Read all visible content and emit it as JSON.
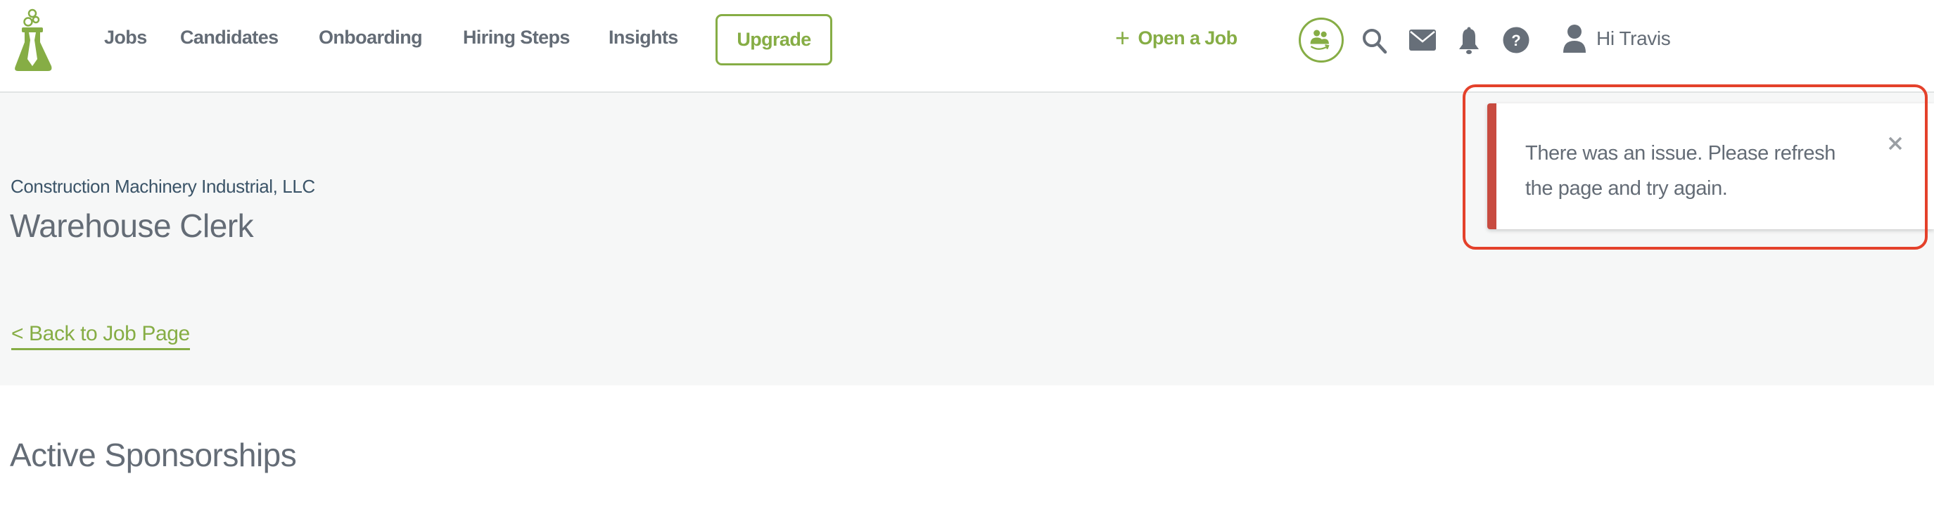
{
  "header": {
    "logo": "flask-tie-logo",
    "nav": [
      {
        "label": "Jobs"
      },
      {
        "label": "Candidates"
      },
      {
        "label": "Onboarding"
      },
      {
        "label": "Hiring Steps"
      },
      {
        "label": "Insights"
      }
    ],
    "upgrade_label": "Upgrade",
    "open_job": {
      "icon": "plus-icon",
      "label": "Open a Job"
    },
    "icons": [
      "talent-pool-icon",
      "search-icon",
      "mail-icon",
      "bell-icon",
      "help-icon"
    ],
    "user": {
      "icon": "user-icon",
      "greeting": "Hi Travis"
    }
  },
  "job": {
    "company": "Construction Machinery Industrial, LLC",
    "title": "Warehouse Clerk",
    "back_link": "< Back to Job Page"
  },
  "main": {
    "section_title": "Active Sponsorships"
  },
  "toast": {
    "type": "error",
    "message": "There was an issue. Please refresh the page and try again.",
    "close_icon": "close-icon"
  },
  "colors": {
    "brand_green": "#86ad45",
    "text_gray": "#646c76",
    "company_blue": "#3b5468",
    "error_red": "#c84b40",
    "highlight_red": "#e4412b",
    "band_bg": "#f6f7f7"
  }
}
